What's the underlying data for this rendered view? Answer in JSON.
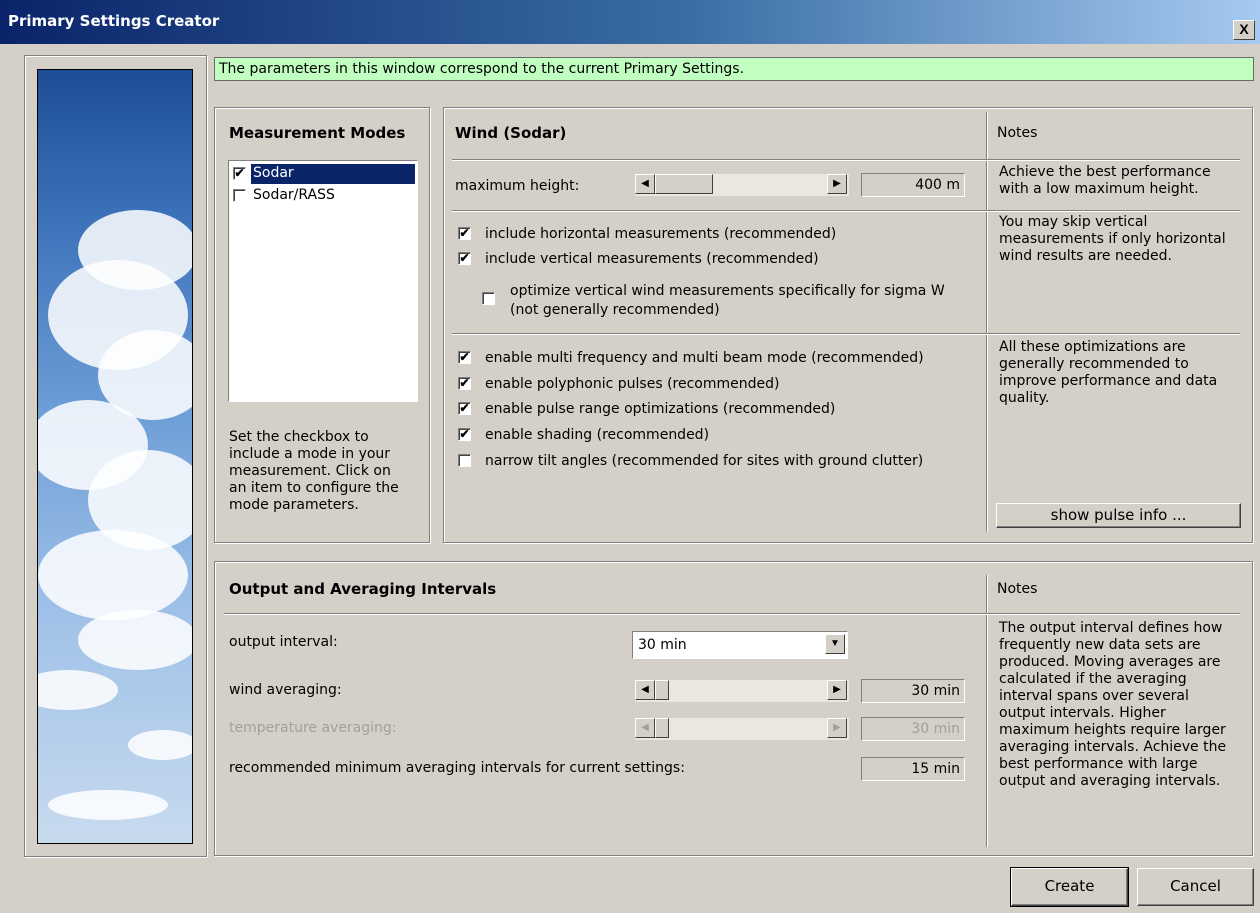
{
  "window": {
    "title": "Primary Settings Creator",
    "close_label": "X"
  },
  "banner": {
    "text": "The parameters in this window correspond to the current Primary Settings."
  },
  "modes": {
    "header": "Measurement Modes",
    "items": [
      {
        "label": "Sodar",
        "checked": true,
        "selected": true
      },
      {
        "label": "Sodar/RASS",
        "checked": false,
        "selected": false
      }
    ],
    "help": [
      "Set the checkbox to",
      "include a mode in your",
      "measurement. Click on",
      "an item to configure the",
      "mode parameters."
    ]
  },
  "wind": {
    "header": "Wind (Sodar)",
    "notes_header": "Notes",
    "max_height_label": "maximum height:",
    "max_height_value": "400 m",
    "max_height_note": [
      "Achieve the best performance",
      "with a low maximum height."
    ],
    "checks1": [
      {
        "label": "include horizontal measurements (recommended)",
        "checked": true
      },
      {
        "label": "include vertical measurements (recommended)",
        "checked": true
      }
    ],
    "sigma_check": {
      "label_line1": "optimize vertical wind measurements specifically for sigma W",
      "label_line2": "(not generally recommended)",
      "checked": false
    },
    "vertical_note": [
      "You may skip vertical",
      "measurements if only horizontal",
      "wind results are needed."
    ],
    "checks2": [
      {
        "label": "enable multi frequency and multi beam mode (recommended)",
        "checked": true
      },
      {
        "label": "enable polyphonic pulses (recommended)",
        "checked": true
      },
      {
        "label": "enable pulse range optimizations (recommended)",
        "checked": true
      },
      {
        "label": "enable shading (recommended)",
        "checked": true
      },
      {
        "label": "narrow tilt angles (recommended for sites with ground clutter)",
        "checked": false
      }
    ],
    "optim_note": [
      "All these optimizations are",
      "generally recommended to",
      "improve performance and data",
      "quality."
    ],
    "pulse_info_button": "show pulse info ..."
  },
  "output": {
    "header": "Output and Averaging Intervals",
    "notes_header": "Notes",
    "output_interval_label": "output interval:",
    "output_interval_value": "30 min",
    "wind_avg_label": "wind averaging:",
    "wind_avg_value": "30 min",
    "temp_avg_label": "temperature averaging:",
    "temp_avg_value": "30 min",
    "recommended_label": "recommended minimum averaging intervals for current settings:",
    "recommended_value": "15 min",
    "note": [
      "The output interval defines how",
      "frequently new data sets are",
      "produced. Moving averages are",
      "calculated if the averaging",
      "interval spans over several",
      "output intervals. Higher",
      "maximum heights require larger",
      "averaging intervals. Achieve the",
      "best performance with large",
      "output and averaging intervals."
    ]
  },
  "buttons": {
    "create": "Create",
    "cancel": "Cancel"
  },
  "icons": {
    "check": "✔",
    "left": "◀",
    "right": "▶",
    "down": "▼"
  }
}
